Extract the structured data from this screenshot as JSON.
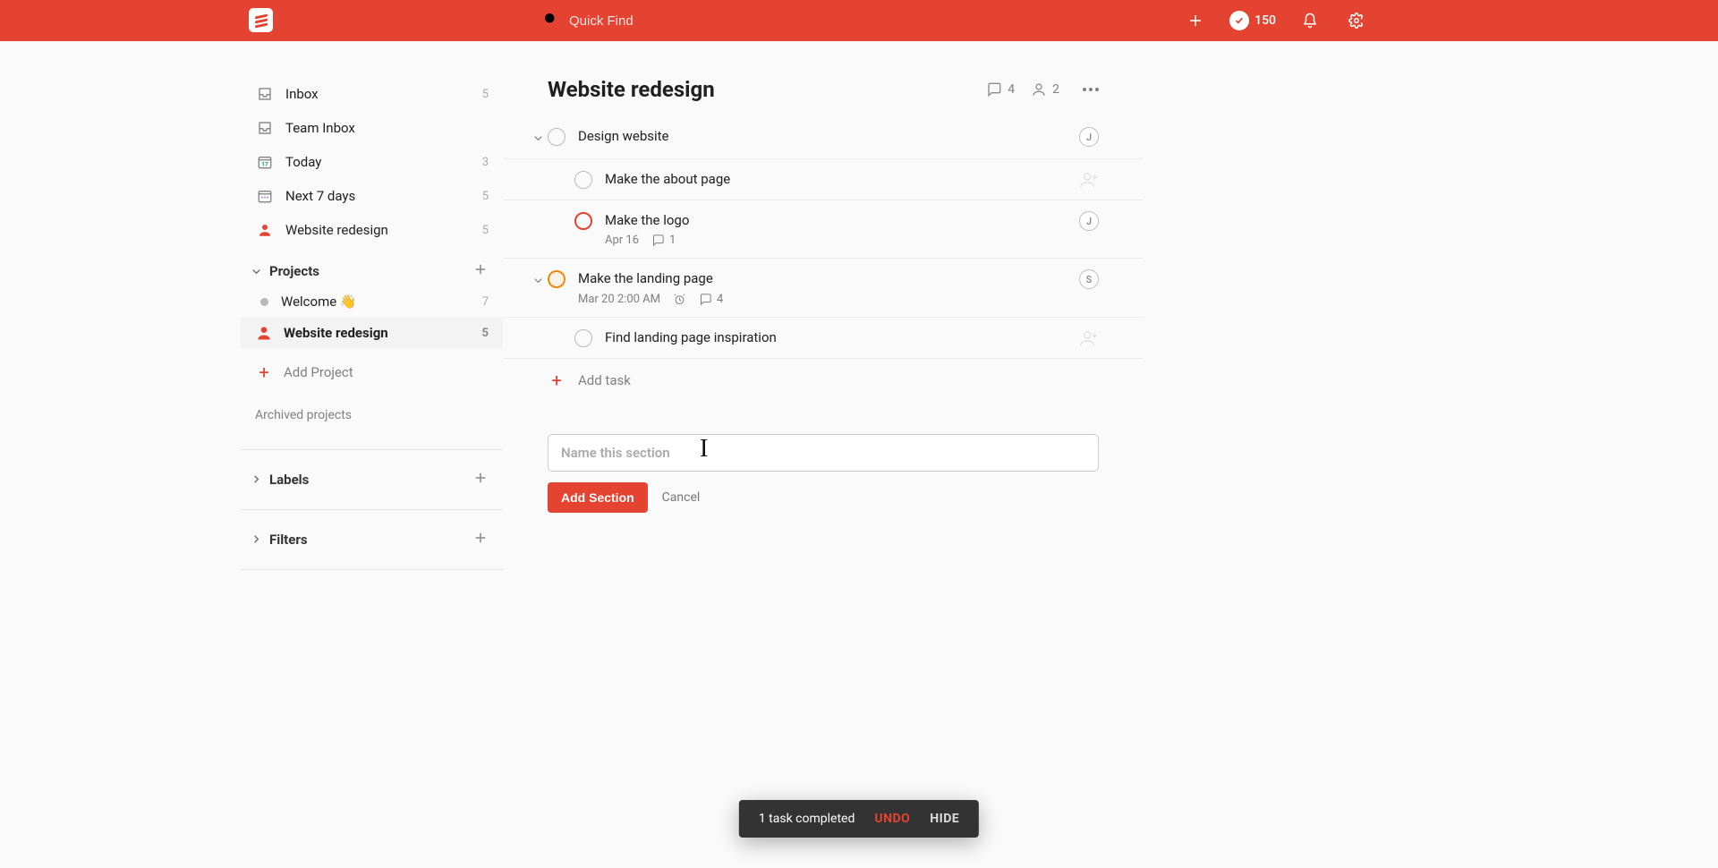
{
  "topbar": {
    "search_placeholder": "Quick Find",
    "karma_count": "150"
  },
  "sidebar": {
    "inbox": {
      "label": "Inbox",
      "count": "5"
    },
    "team_inbox": {
      "label": "Team Inbox",
      "count": ""
    },
    "today": {
      "label": "Today",
      "count": "3"
    },
    "next7": {
      "label": "Next 7 days",
      "count": "5"
    },
    "shared_wr": {
      "label": "Website redesign",
      "count": "5"
    },
    "projects_header": "Projects",
    "projects": [
      {
        "label": "Welcome 👋",
        "count": "7",
        "selected": false
      },
      {
        "label": "Website redesign",
        "count": "5",
        "selected": true
      }
    ],
    "add_project_label": "Add Project",
    "archived_label": "Archived projects",
    "labels_header": "Labels",
    "filters_header": "Filters"
  },
  "project": {
    "title": "Website redesign",
    "comment_count": "4",
    "share_count": "2"
  },
  "tasks": [
    {
      "id": "t1",
      "level": 0,
      "collapsible": true,
      "priority": "none",
      "title": "Design website",
      "meta": [],
      "avatar_right": "J"
    },
    {
      "id": "t2",
      "level": 1,
      "collapsible": false,
      "priority": "none",
      "title": "Make the about page",
      "meta": [],
      "avatar_right": null,
      "show_assign": true
    },
    {
      "id": "t3",
      "level": 1,
      "collapsible": false,
      "priority": "red",
      "title": "Make the logo",
      "meta": [
        {
          "kind": "date",
          "text": "Apr 16"
        },
        {
          "kind": "comment",
          "text": "1"
        }
      ],
      "avatar_right": "J"
    },
    {
      "id": "t4",
      "level": 0,
      "collapsible": true,
      "priority": "yellow",
      "title": "Make the landing page",
      "meta": [
        {
          "kind": "date",
          "text": "Mar 20 2:00 AM"
        },
        {
          "kind": "reminder",
          "text": ""
        },
        {
          "kind": "comment",
          "text": "4"
        }
      ],
      "avatar_right": "S"
    },
    {
      "id": "t5",
      "level": 1,
      "collapsible": false,
      "priority": "none",
      "title": "Find landing page inspiration",
      "meta": [],
      "avatar_right": null,
      "show_assign": true
    }
  ],
  "add_task_label": "Add task",
  "section": {
    "placeholder": "Name this section",
    "submit_label": "Add Section",
    "cancel_label": "Cancel"
  },
  "toast": {
    "message": "1 task completed",
    "undo": "UNDO",
    "hide": "HIDE"
  }
}
